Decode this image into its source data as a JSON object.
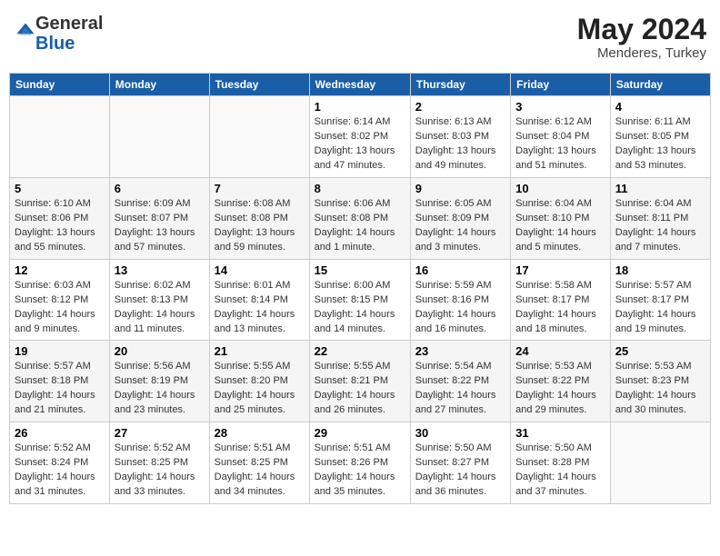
{
  "logo": {
    "general": "General",
    "blue": "Blue"
  },
  "header": {
    "month": "May 2024",
    "location": "Menderes, Turkey"
  },
  "weekdays": [
    "Sunday",
    "Monday",
    "Tuesday",
    "Wednesday",
    "Thursday",
    "Friday",
    "Saturday"
  ],
  "weeks": [
    [
      {
        "day": "",
        "info": ""
      },
      {
        "day": "",
        "info": ""
      },
      {
        "day": "",
        "info": ""
      },
      {
        "day": "1",
        "info": "Sunrise: 6:14 AM\nSunset: 8:02 PM\nDaylight: 13 hours\nand 47 minutes."
      },
      {
        "day": "2",
        "info": "Sunrise: 6:13 AM\nSunset: 8:03 PM\nDaylight: 13 hours\nand 49 minutes."
      },
      {
        "day": "3",
        "info": "Sunrise: 6:12 AM\nSunset: 8:04 PM\nDaylight: 13 hours\nand 51 minutes."
      },
      {
        "day": "4",
        "info": "Sunrise: 6:11 AM\nSunset: 8:05 PM\nDaylight: 13 hours\nand 53 minutes."
      }
    ],
    [
      {
        "day": "5",
        "info": "Sunrise: 6:10 AM\nSunset: 8:06 PM\nDaylight: 13 hours\nand 55 minutes."
      },
      {
        "day": "6",
        "info": "Sunrise: 6:09 AM\nSunset: 8:07 PM\nDaylight: 13 hours\nand 57 minutes."
      },
      {
        "day": "7",
        "info": "Sunrise: 6:08 AM\nSunset: 8:08 PM\nDaylight: 13 hours\nand 59 minutes."
      },
      {
        "day": "8",
        "info": "Sunrise: 6:06 AM\nSunset: 8:08 PM\nDaylight: 14 hours\nand 1 minute."
      },
      {
        "day": "9",
        "info": "Sunrise: 6:05 AM\nSunset: 8:09 PM\nDaylight: 14 hours\nand 3 minutes."
      },
      {
        "day": "10",
        "info": "Sunrise: 6:04 AM\nSunset: 8:10 PM\nDaylight: 14 hours\nand 5 minutes."
      },
      {
        "day": "11",
        "info": "Sunrise: 6:04 AM\nSunset: 8:11 PM\nDaylight: 14 hours\nand 7 minutes."
      }
    ],
    [
      {
        "day": "12",
        "info": "Sunrise: 6:03 AM\nSunset: 8:12 PM\nDaylight: 14 hours\nand 9 minutes."
      },
      {
        "day": "13",
        "info": "Sunrise: 6:02 AM\nSunset: 8:13 PM\nDaylight: 14 hours\nand 11 minutes."
      },
      {
        "day": "14",
        "info": "Sunrise: 6:01 AM\nSunset: 8:14 PM\nDaylight: 14 hours\nand 13 minutes."
      },
      {
        "day": "15",
        "info": "Sunrise: 6:00 AM\nSunset: 8:15 PM\nDaylight: 14 hours\nand 14 minutes."
      },
      {
        "day": "16",
        "info": "Sunrise: 5:59 AM\nSunset: 8:16 PM\nDaylight: 14 hours\nand 16 minutes."
      },
      {
        "day": "17",
        "info": "Sunrise: 5:58 AM\nSunset: 8:17 PM\nDaylight: 14 hours\nand 18 minutes."
      },
      {
        "day": "18",
        "info": "Sunrise: 5:57 AM\nSunset: 8:17 PM\nDaylight: 14 hours\nand 19 minutes."
      }
    ],
    [
      {
        "day": "19",
        "info": "Sunrise: 5:57 AM\nSunset: 8:18 PM\nDaylight: 14 hours\nand 21 minutes."
      },
      {
        "day": "20",
        "info": "Sunrise: 5:56 AM\nSunset: 8:19 PM\nDaylight: 14 hours\nand 23 minutes."
      },
      {
        "day": "21",
        "info": "Sunrise: 5:55 AM\nSunset: 8:20 PM\nDaylight: 14 hours\nand 25 minutes."
      },
      {
        "day": "22",
        "info": "Sunrise: 5:55 AM\nSunset: 8:21 PM\nDaylight: 14 hours\nand 26 minutes."
      },
      {
        "day": "23",
        "info": "Sunrise: 5:54 AM\nSunset: 8:22 PM\nDaylight: 14 hours\nand 27 minutes."
      },
      {
        "day": "24",
        "info": "Sunrise: 5:53 AM\nSunset: 8:22 PM\nDaylight: 14 hours\nand 29 minutes."
      },
      {
        "day": "25",
        "info": "Sunrise: 5:53 AM\nSunset: 8:23 PM\nDaylight: 14 hours\nand 30 minutes."
      }
    ],
    [
      {
        "day": "26",
        "info": "Sunrise: 5:52 AM\nSunset: 8:24 PM\nDaylight: 14 hours\nand 31 minutes."
      },
      {
        "day": "27",
        "info": "Sunrise: 5:52 AM\nSunset: 8:25 PM\nDaylight: 14 hours\nand 33 minutes."
      },
      {
        "day": "28",
        "info": "Sunrise: 5:51 AM\nSunset: 8:25 PM\nDaylight: 14 hours\nand 34 minutes."
      },
      {
        "day": "29",
        "info": "Sunrise: 5:51 AM\nSunset: 8:26 PM\nDaylight: 14 hours\nand 35 minutes."
      },
      {
        "day": "30",
        "info": "Sunrise: 5:50 AM\nSunset: 8:27 PM\nDaylight: 14 hours\nand 36 minutes."
      },
      {
        "day": "31",
        "info": "Sunrise: 5:50 AM\nSunset: 8:28 PM\nDaylight: 14 hours\nand 37 minutes."
      },
      {
        "day": "",
        "info": ""
      }
    ]
  ]
}
